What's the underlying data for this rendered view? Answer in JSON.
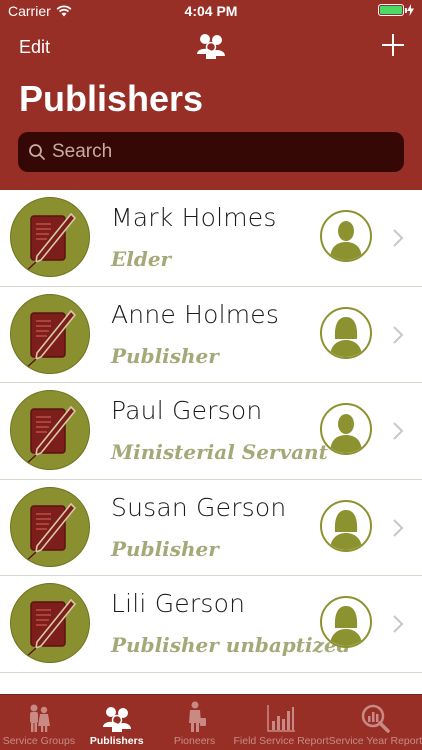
{
  "status_bar": {
    "carrier": "Carrier",
    "time": "4:04 PM"
  },
  "nav": {
    "edit_label": "Edit",
    "center_icon": "publishers-icon",
    "add_icon": "plus-icon"
  },
  "page_title": "Publishers",
  "search": {
    "placeholder": "Search"
  },
  "publishers": [
    {
      "name": "Mark Holmes",
      "role": "Elder",
      "gender": "male"
    },
    {
      "name": "Anne Holmes",
      "role": "Publisher",
      "gender": "female"
    },
    {
      "name": "Paul Gerson",
      "role": "Ministerial Servant",
      "gender": "male"
    },
    {
      "name": "Susan Gerson",
      "role": "Publisher",
      "gender": "female"
    },
    {
      "name": "Lili Gerson",
      "role": "Publisher unbaptized",
      "gender": "female"
    }
  ],
  "tabs": [
    {
      "label": "Service Groups",
      "icon": "service-groups-icon",
      "active": false
    },
    {
      "label": "Publishers",
      "icon": "publishers-icon",
      "active": true
    },
    {
      "label": "Pioneers",
      "icon": "pioneers-icon",
      "active": false
    },
    {
      "label": "Field Service Report",
      "icon": "bar-chart-icon",
      "active": false
    },
    {
      "label": "Service Year Report",
      "icon": "chart-search-icon",
      "active": false
    }
  ],
  "colors": {
    "header_bg": "#972f27",
    "search_bg": "#350705",
    "accent_olive": "#8d9230",
    "role_text": "#a5a877",
    "battery": "#4cd964"
  }
}
